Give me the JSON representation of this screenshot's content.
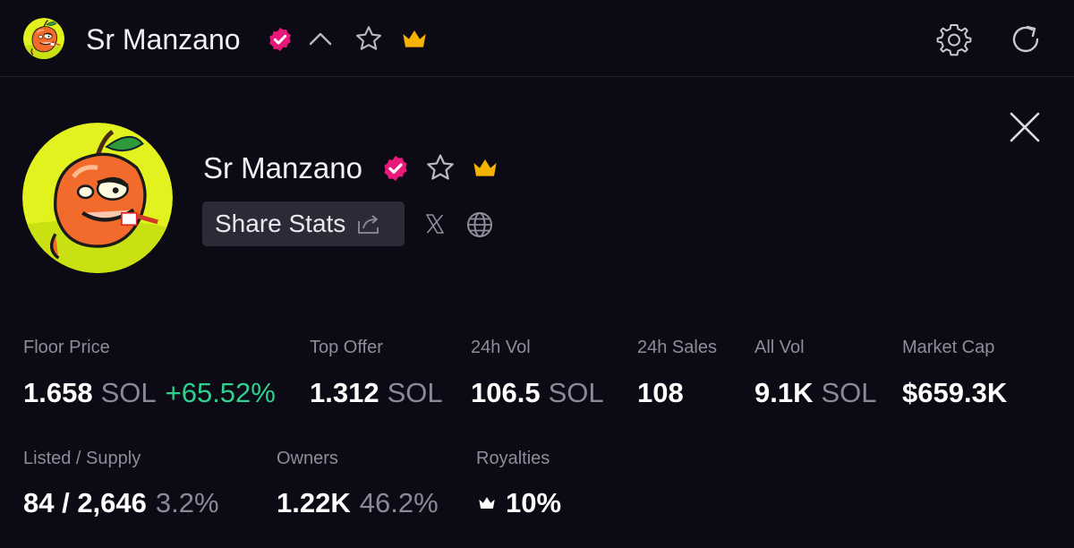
{
  "header": {
    "title": "Sr Manzano",
    "icons": {
      "avatar": "apple-character-avatar",
      "verified": "verified-badge-icon",
      "collapse": "chevron-up-icon",
      "favorite": "star-outline-icon",
      "premium": "crown-icon",
      "settings": "gear-icon",
      "refresh": "refresh-icon"
    }
  },
  "profile": {
    "name": "Sr Manzano",
    "share_label": "Share Stats",
    "icons": {
      "share": "share-icon",
      "x": "x-logo-icon",
      "website": "globe-icon",
      "close": "close-icon"
    }
  },
  "colors": {
    "background": "#0c0a14",
    "verified": "#e8197a",
    "crown": "#f5b301",
    "positive": "#2fd08e",
    "muted": "#8f8c9a"
  },
  "stats_row1": [
    {
      "label": "Floor Price",
      "value": "1.658",
      "unit": "SOL",
      "change": "+65.52%"
    },
    {
      "label": "Top Offer",
      "value": "1.312",
      "unit": "SOL"
    },
    {
      "label": "24h Vol",
      "value": "106.5",
      "unit": "SOL"
    },
    {
      "label": "24h Sales",
      "value": "108"
    },
    {
      "label": "All Vol",
      "value": "9.1K",
      "unit": "SOL"
    },
    {
      "label": "Market Cap",
      "value": "$659.3K"
    }
  ],
  "stats_row2": [
    {
      "label": "Listed / Supply",
      "value": "84 / 2,646",
      "pct": "3.2%"
    },
    {
      "label": "Owners",
      "value": "1.22K",
      "pct": "46.2%"
    },
    {
      "label": "Royalties",
      "value": "10%",
      "icon": "crown-icon"
    }
  ]
}
